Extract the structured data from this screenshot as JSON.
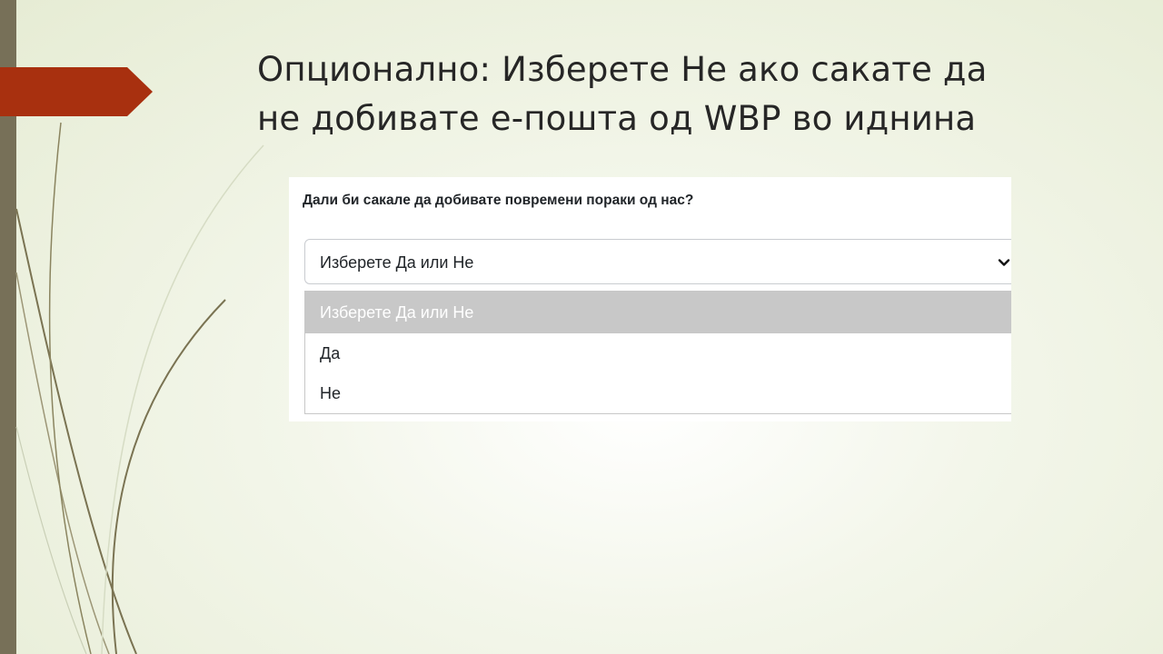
{
  "slide": {
    "title_line1": "Опционално: Изберете Не ако сакате да",
    "title_line2": "не добивате е-пошта од WBP во иднина"
  },
  "form": {
    "question": "Дали би сакале да добивате повремени пораки од нас?",
    "select_value": "Изберете Да или Не",
    "options": [
      {
        "label": "Изберете Да или Не",
        "highlighted": true
      },
      {
        "label": "Да",
        "highlighted": false
      },
      {
        "label": "Не",
        "highlighted": false
      }
    ]
  },
  "colors": {
    "accent_tab": "#a8300f",
    "left_bar": "#777058",
    "highlight_option": "#c8c8c8"
  },
  "icons": {
    "dropdown": "chevron-down-icon"
  }
}
